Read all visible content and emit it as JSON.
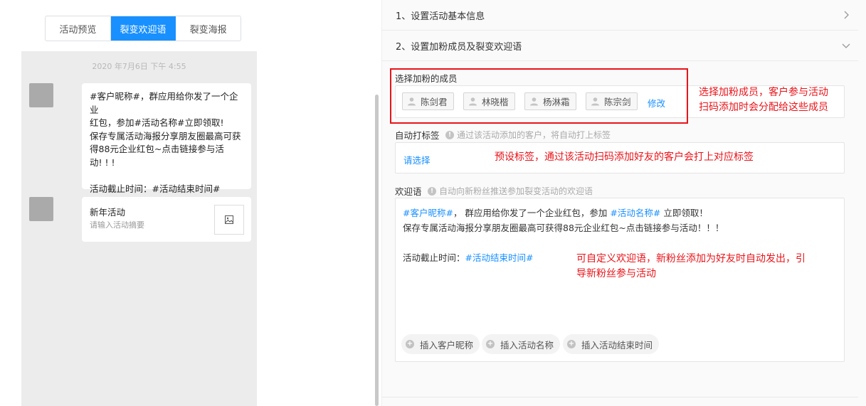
{
  "preview": {
    "tabs": [
      {
        "label": "活动预览",
        "active": false
      },
      {
        "label": "裂变欢迎语",
        "active": true
      },
      {
        "label": "裂变海报",
        "active": false
      }
    ],
    "timestamp": "2020 年7月6日 下午 4:55",
    "message": {
      "lines": [
        "#客户昵称#，群应用给你发了一个企业",
        "红包，参加#活动名称#立即领取!",
        "保存专属活动海报分享朋友圈最高可获",
        "得88元企业红包~点击链接参与活",
        "动! ! !",
        "",
        "活动截止时间：#活动结束时间#"
      ]
    },
    "card": {
      "title": "新年活动",
      "summary": "请输入活动摘要",
      "image_icon": "image-icon"
    }
  },
  "panel": {
    "section1_title": "1、设置活动基本信息",
    "section2_title": "2、设置加粉成员及裂变欢迎语",
    "members": {
      "label": "选择加粉的成员",
      "items": [
        "陈剑君",
        "林晓楷",
        "杨淋霜",
        "陈宗剑"
      ],
      "edit_label": "修改"
    },
    "auto_tag": {
      "label": "自动打标签",
      "hint": "通过该活动添加的客户，将自动打上标签",
      "select_placeholder": "请选择"
    },
    "welcome": {
      "label": "欢迎语",
      "hint": "自动向新粉丝推送参加裂变活动的欢迎语",
      "line1_var1": "#客户昵称#",
      "line1_text1": "， 群应用给你发了一个企业红包，参加 ",
      "line1_var2": "#活动名称#",
      "line1_text2": " 立即领取！",
      "line2": "保存专属活动海报分享朋友圈最高可获得88元企业红包~点击链接参与活动！！！",
      "line3_text": "活动截止时间：",
      "line3_var": "#活动结束时间#",
      "insert_buttons": [
        "插入客户昵称",
        "插入活动名称",
        "插入活动结束时间"
      ]
    }
  },
  "annotations": {
    "members_note_lines": [
      "选择加粉成员，客户参与活动",
      "扫码添加时会分配给这些成员"
    ],
    "tag_note": "预设标签，通过该活动扫码添加好友的客户会打上对应标签",
    "welcome_note_lines": [
      "可自定义欢迎语，新粉丝添加为好友时自动发出，引",
      "导新粉丝参与活动"
    ]
  },
  "colors": {
    "accent": "#1890ff",
    "annotation": "#e8141a"
  }
}
